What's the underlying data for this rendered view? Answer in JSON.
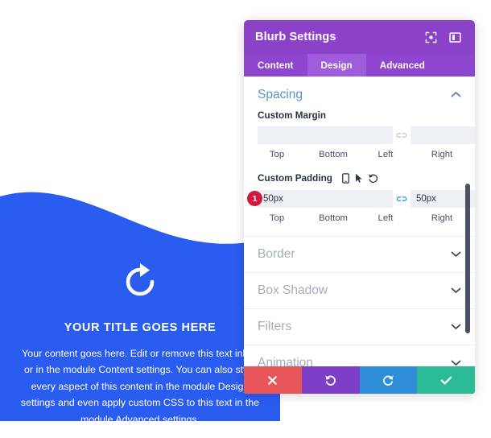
{
  "blurb": {
    "icon": "refresh-circular-arrow-icon",
    "title": "YOUR TITLE GOES HERE",
    "body": "Your content goes here. Edit or remove this text inline or in the module Content settings. You can also style every aspect of this content in the module Design settings and even apply custom CSS to this text in the module Advanced settings.",
    "background_color": "#2b5cf0",
    "text_color": "#ffffff"
  },
  "modal": {
    "title": "Blurb Settings",
    "header_color": "#8b42c9",
    "header_icons": [
      {
        "name": "expand-fullscreen-icon"
      },
      {
        "name": "layout-panel-icon"
      }
    ],
    "tabs": [
      {
        "label": "Content",
        "active": false
      },
      {
        "label": "Design",
        "active": true
      },
      {
        "label": "Advanced",
        "active": false
      }
    ],
    "spacing": {
      "title": "Spacing",
      "expanded": true,
      "toggle_icon": "chevron-up-icon",
      "accent_color": "#5b93c7",
      "custom_margin": {
        "label": "Custom Margin",
        "fields": [
          {
            "caption": "Top",
            "value": "",
            "placeholder": ""
          },
          {
            "caption": "Bottom",
            "value": "",
            "placeholder": ""
          },
          {
            "caption": "Left",
            "value": "",
            "placeholder": ""
          },
          {
            "caption": "Right",
            "value": "",
            "placeholder": ""
          }
        ],
        "link_icon": "link-chain-icon",
        "link_active": false
      },
      "custom_padding": {
        "label": "Custom Padding",
        "badge": "1",
        "badge_color": "#d4193e",
        "icons": [
          {
            "name": "mobile-device-icon"
          },
          {
            "name": "cursor-arrow-icon"
          },
          {
            "name": "reset-undo-icon"
          }
        ],
        "fields": [
          {
            "caption": "Top",
            "value": "50px",
            "placeholder": "50px"
          },
          {
            "caption": "Bottom",
            "value": "50px",
            "placeholder": "50px"
          },
          {
            "caption": "Left",
            "value": "50px",
            "placeholder": "50px"
          },
          {
            "caption": "Right",
            "value": "50px",
            "placeholder": "50px"
          }
        ],
        "link_icon": "link-chain-icon",
        "link_active": true
      }
    },
    "sections": [
      {
        "label": "Border",
        "toggle_icon": "chevron-down-icon"
      },
      {
        "label": "Box Shadow",
        "toggle_icon": "chevron-down-icon"
      },
      {
        "label": "Filters",
        "toggle_icon": "chevron-down-icon"
      },
      {
        "label": "Animation",
        "toggle_icon": "chevron-down-icon"
      }
    ],
    "footer_buttons": [
      {
        "name": "cancel-button",
        "icon": "close-x-icon",
        "color": "#e8565a"
      },
      {
        "name": "undo-button",
        "icon": "undo-arrow-icon",
        "color": "#7e3ec8"
      },
      {
        "name": "redo-button",
        "icon": "redo-arrow-icon",
        "color": "#2f8cd6"
      },
      {
        "name": "save-button",
        "icon": "check-icon",
        "color": "#2bbc97"
      }
    ],
    "scrollbar_color": "#4a5161"
  }
}
